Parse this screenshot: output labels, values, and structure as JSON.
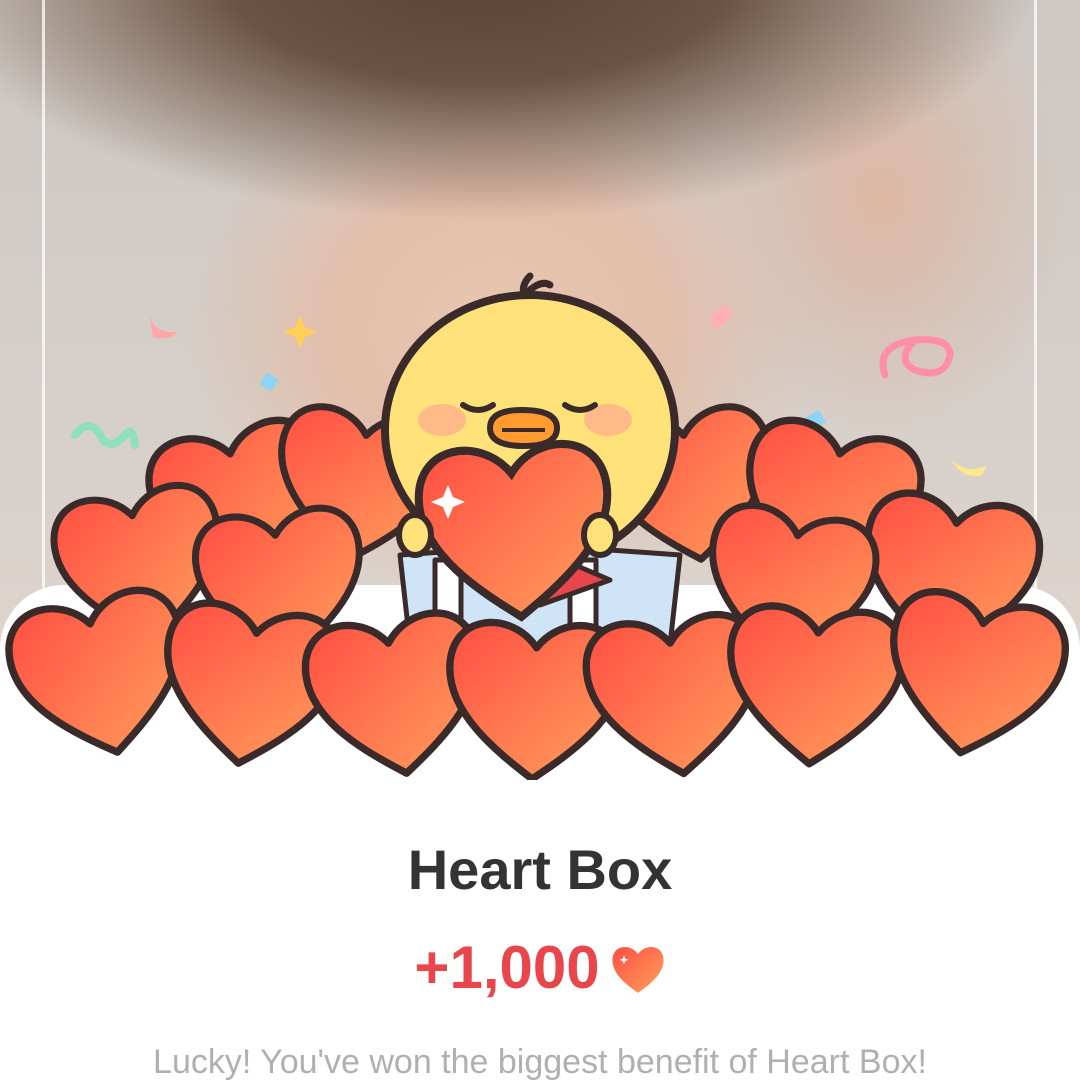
{
  "background": {
    "description_icon": "person-photo"
  },
  "popup": {
    "title": "Heart Box",
    "reward_amount": "+1,000",
    "reward_icon": "heart-icon",
    "message": "Lucky! You've won the biggest benefit of Heart Box!"
  },
  "colors": {
    "reward_red": "#e8464b",
    "heart_top": "#ff4e43",
    "heart_bottom": "#ffa15c",
    "chick_yellow": "#ffe27a",
    "title_dark": "#333333",
    "message_gray": "#b0b0b0"
  }
}
